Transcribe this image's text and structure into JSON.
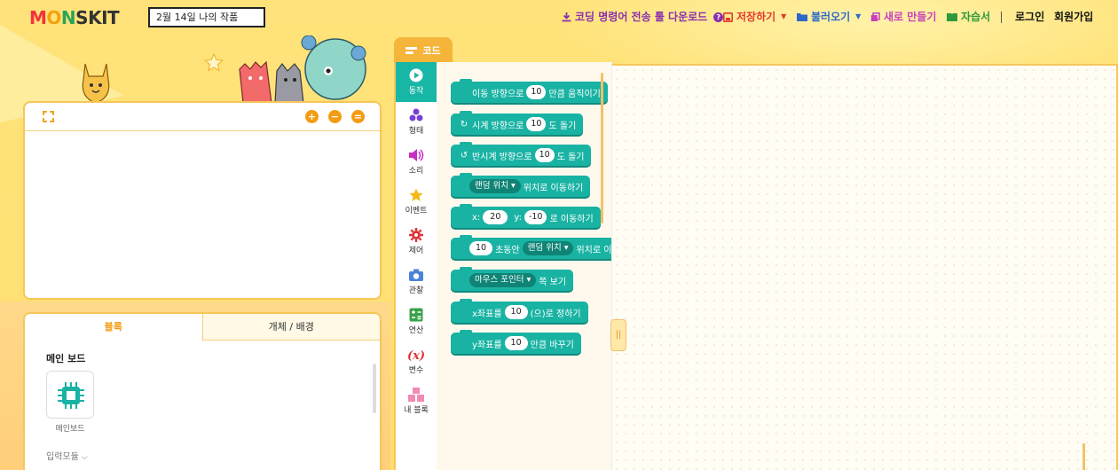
{
  "app": {
    "logo": [
      "M",
      "O",
      "N",
      "S",
      "K",
      "I",
      "T"
    ],
    "project_title": "2월 14일 나의 작품"
  },
  "menu": {
    "download": "코딩 명령어 전송 툴 다운로드",
    "help_glyph": "?",
    "save": "저장하기",
    "load": "불러오기",
    "new": "새로 만들기",
    "tutorial": "자습서",
    "login": "로그인",
    "signup": "회원가입"
  },
  "stage": {
    "zoom_in": "+",
    "zoom_out": "−",
    "zoom_reset": "="
  },
  "objects_panel": {
    "tabs": [
      "블록",
      "개체 / 배경"
    ],
    "section_title": "메인 보드",
    "board_label": "메인보드",
    "input_modules": "입력모듈"
  },
  "code_tab": "코드",
  "categories": [
    "동작",
    "형태",
    "소리",
    "이벤트",
    "제어",
    "관찰",
    "연산",
    "변수",
    "내 블록"
  ],
  "blocks": [
    {
      "pre": "이동 방향으로",
      "val": "10",
      "post": "만큼 움직이기"
    },
    {
      "pre": "시계 방향으로",
      "val": "10",
      "post": "도 돌기"
    },
    {
      "pre": "반시계 방향으로",
      "val": "10",
      "post": "도 돌기"
    },
    {
      "drop": "랜덤 위치",
      "post": "위치로 이동하기"
    },
    {
      "xl": "x:",
      "xv": "20",
      "yl": "y:",
      "yv": "-10",
      "post": "로 이동하기"
    },
    {
      "val": "10",
      "mid": "초동안",
      "drop": "랜덤 위치",
      "post": "위치로 이동"
    },
    {
      "drop": "마우스 포인터",
      "post": "쪽 보기"
    },
    {
      "pre": "x좌표를",
      "val": "10",
      "post": "(으)로 정하기"
    },
    {
      "pre": "y좌표를",
      "val": "10",
      "post": "만큼 바꾸기"
    }
  ],
  "colors": {
    "accent": "#f39c12",
    "block": "#19b3a3",
    "background": "#ffe37a"
  }
}
